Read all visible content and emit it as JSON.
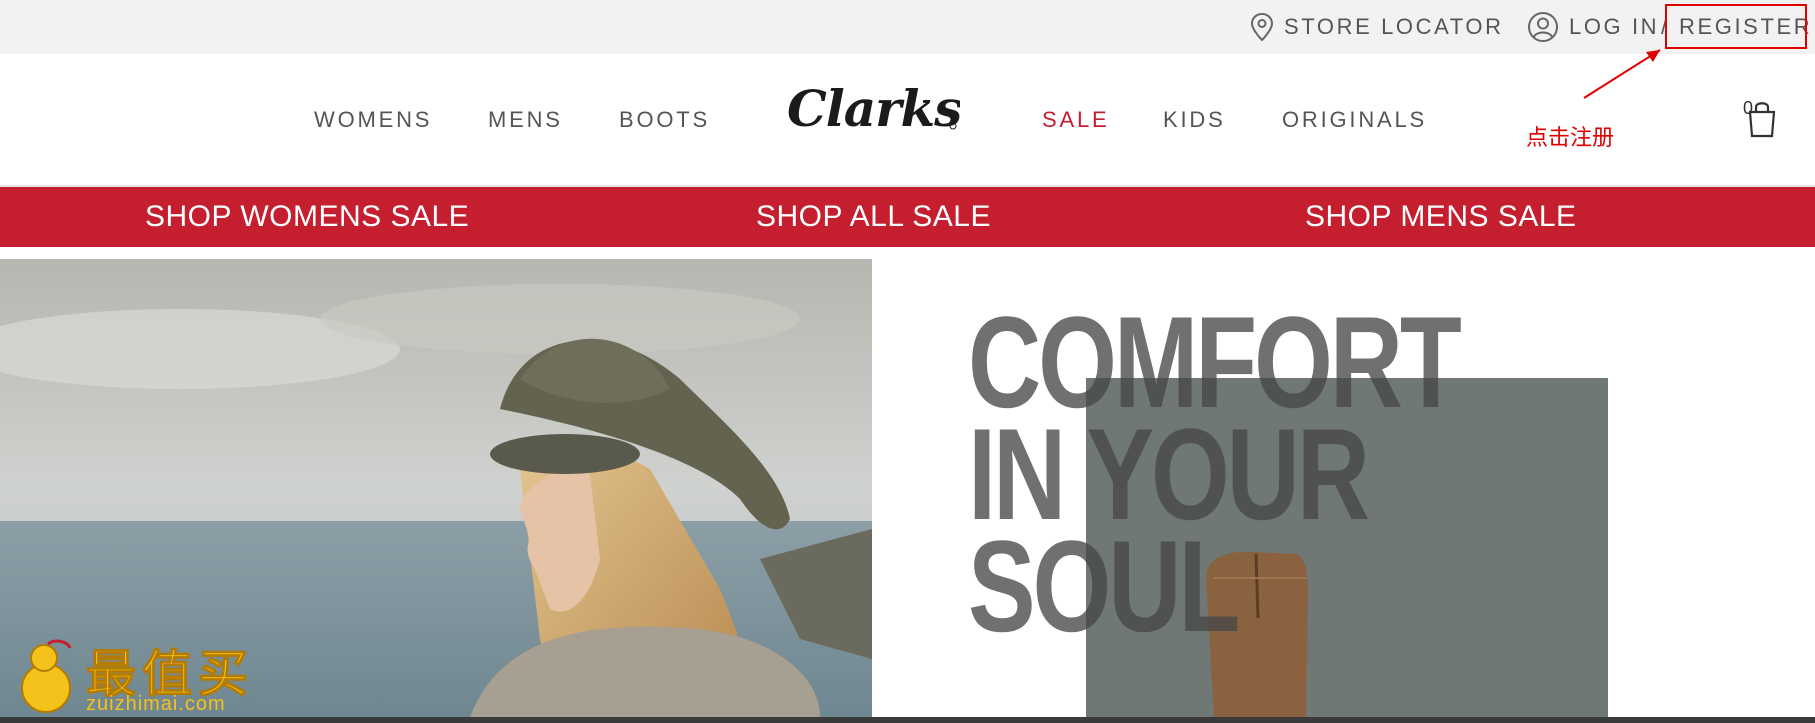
{
  "topbar": {
    "store_locator": "STORE LOCATOR",
    "login": "LOG IN",
    "separator": "/",
    "register": "REGISTER"
  },
  "nav": {
    "logo": "Clarks",
    "items": [
      "WOMENS",
      "MENS",
      "BOOTS",
      "SALE",
      "KIDS",
      "ORIGINALS"
    ],
    "cart_count": "0"
  },
  "annotation": "点击注册",
  "sale_bar": [
    "SHOP WOMENS SALE",
    "SHOP ALL SALE",
    "SHOP MENS SALE"
  ],
  "hero": {
    "headline": "COMFORT\nIN YOUR\nSOUL"
  },
  "watermark": {
    "text": "最值买",
    "url": "zuizhimai.com"
  },
  "colors": {
    "accent": "#c41e2f",
    "annotation": "#e00000",
    "topbar_bg": "#f2f2f2"
  }
}
